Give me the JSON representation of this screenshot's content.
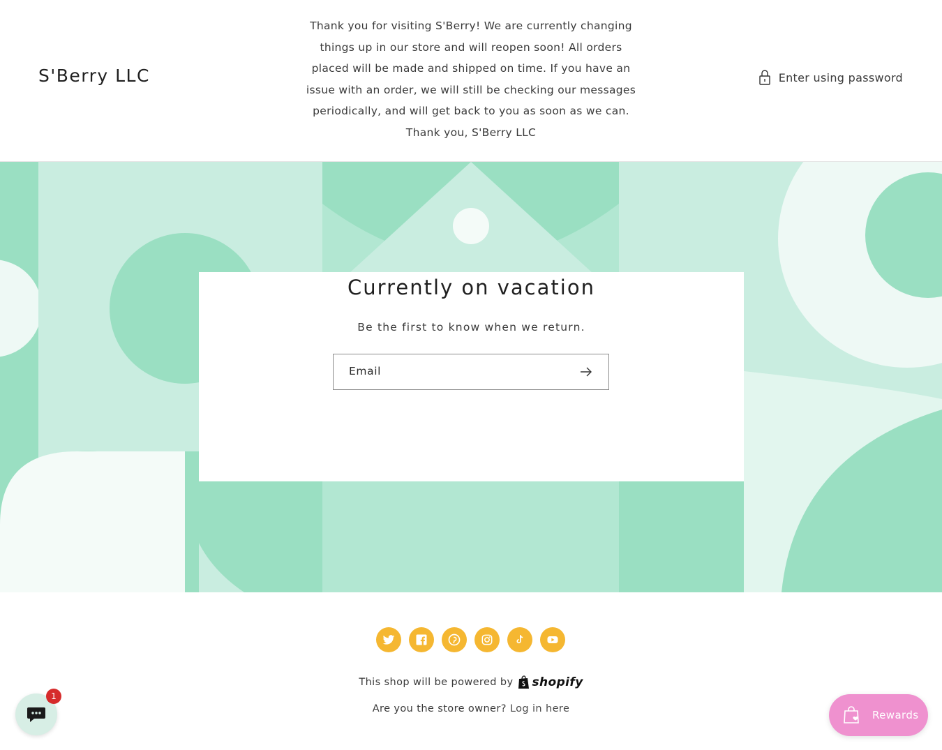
{
  "header": {
    "brand": "S'Berry LLC",
    "notice_lines": [
      "Thank you for visiting S'Berry! We are currently changing",
      "things up in our store and will reopen soon! All orders",
      "placed will be made and shipped on time. If you have an",
      "issue with an order, we will still be checking our messages",
      "periodically, and will get back to you as soon as we can.",
      "Thank you, S'Berry LLC"
    ],
    "password_link": "Enter using password",
    "password_icon": "lock-icon"
  },
  "banner": {
    "title": "Currently on vacation",
    "subtitle": "Be the first to know when we return.",
    "email_label": "Email",
    "submit_icon": "arrow-right-icon"
  },
  "footer": {
    "socials": [
      {
        "name": "twitter-icon"
      },
      {
        "name": "facebook-icon"
      },
      {
        "name": "pinterest-icon"
      },
      {
        "name": "instagram-icon"
      },
      {
        "name": "tiktok-icon"
      },
      {
        "name": "youtube-icon"
      }
    ],
    "powered_text": "This shop will be powered by",
    "shopify_label": "shopify",
    "owner_question": "Are you the store owner?",
    "login_link": "Log in here"
  },
  "chat": {
    "badge_count": "1"
  },
  "rewards": {
    "label": "Rewards"
  },
  "colors": {
    "accent_yellow": "#f5b731",
    "mint_light": "#c9ede0",
    "mint_mid": "#9adfc2",
    "rewards_pink": "#ef91cf",
    "badge_red": "#d62b2b"
  }
}
